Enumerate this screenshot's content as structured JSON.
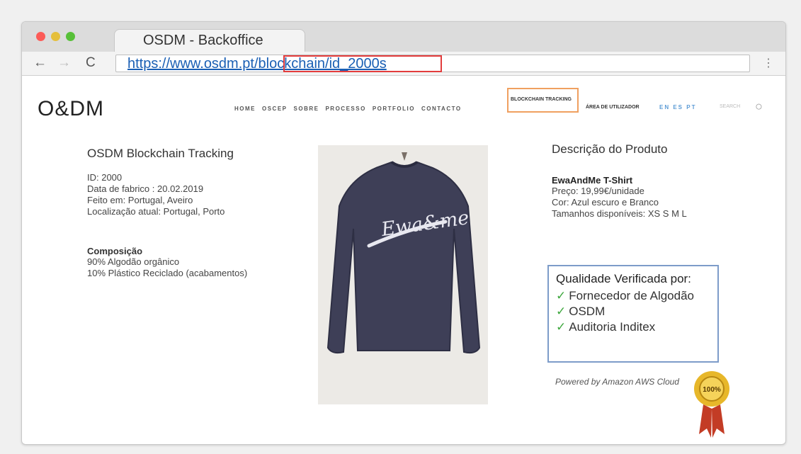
{
  "browser": {
    "tab_title": "OSDM - Backoffice",
    "url": "https://www.osdm.pt/blockchain/id_2000s",
    "menu_icon": "menu-dots-icon"
  },
  "header": {
    "logo": "O&DM",
    "nav": [
      "HOME",
      "OSCEP",
      "SOBRE",
      "PROCESSO",
      "PORTFOLIO",
      "CONTACTO"
    ],
    "tracking": "BLOCKCHAIN TRACKING",
    "area": "ÁREA DE UTILIZADOR",
    "langs": "EN  ES  PT",
    "search_placeholder": "SEARCH"
  },
  "left": {
    "title": "OSDM Blockchain Tracking",
    "lines": [
      "ID: 2000",
      "Data de fabrico : 20.02.2019",
      "Feito em: Portugal, Aveiro",
      "Localização atual: Portugal, Porto"
    ],
    "composition_title": "Composição",
    "composition": [
      "90% Algodão orgânico",
      "10% Plástico Reciclado (acabamentos)"
    ]
  },
  "product": {
    "heading": "Descrição do Produto",
    "name": "EwaAndMe T-Shirt",
    "lines": [
      "Preço: 19,99€/unidade",
      "Cor: Azul escuro e Branco",
      "Tamanhos disponíveis: XS S M L"
    ],
    "shirt_text": "Ewa&me"
  },
  "verification": {
    "title": "Qualidade Verificada por:",
    "items": [
      "Fornecedor de Algodão",
      "OSDM",
      "Auditoria Inditex"
    ]
  },
  "footer": {
    "powered": "Powered by Amazon AWS Cloud",
    "seal": "100%"
  }
}
